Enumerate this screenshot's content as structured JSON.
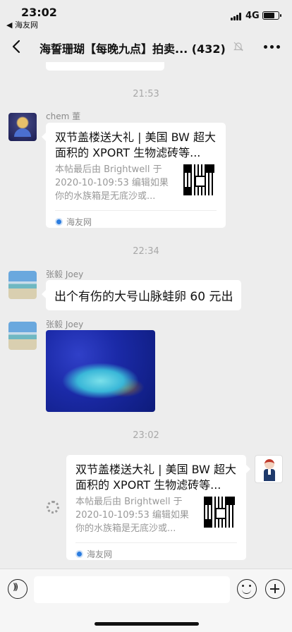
{
  "status_bar": {
    "time": "23:02",
    "back_app": "◀ 海友网",
    "network": "4G",
    "battery_level": 0.8
  },
  "navbar": {
    "title": "海誓珊瑚【每晚九点】拍卖... (432)",
    "icons": [
      "back-arrow-icon",
      "mute-bell-icon",
      "more-icon"
    ]
  },
  "messages": {
    "sep1": "21:53",
    "msg1": {
      "sender": "chem 董",
      "title": "双节盖楼送大礼 | 美国 BW 超大面积的 XPORT 生物滤砖等...",
      "desc": "本帖最后由 Brightwell 于 2020-10-109:53 编辑如果你的水族箱是无底沙或...",
      "source": "海友网"
    },
    "sep2": "22:34",
    "msg2": {
      "sender": "张毅 Joey",
      "text": "出个有伤的大号山脉蛙卵 60 元出"
    },
    "msg3": {
      "sender": "张毅 Joey"
    },
    "sep3": "23:02",
    "msg4": {
      "title": "双节盖楼送大礼 | 美国 BW 超大面积的 XPORT 生物滤砖等...",
      "desc": "本帖最后由 Brightwell 于 2020-10-109:53 编辑如果你的水族箱是无底沙或...",
      "source": "海友网"
    }
  },
  "input_bar": {
    "icons": [
      "voice-icon",
      "emoji-icon",
      "plus-icon"
    ]
  }
}
